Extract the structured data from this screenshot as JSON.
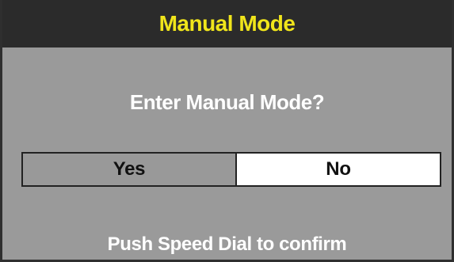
{
  "dialog": {
    "title": "Manual Mode",
    "question": "Enter Manual Mode?",
    "options": [
      {
        "label": "Yes",
        "selected": false
      },
      {
        "label": "No",
        "selected": true
      }
    ],
    "instruction": "Push Speed Dial to confirm"
  },
  "colors": {
    "title_bar_background": "#2b2b2b",
    "title_text": "#f0e51b",
    "panel_background": "#9a9a9a",
    "selected_option_background": "#ffffff",
    "unselected_option_background": "#999999",
    "text_primary": "#ffffff",
    "option_text": "#111111"
  }
}
